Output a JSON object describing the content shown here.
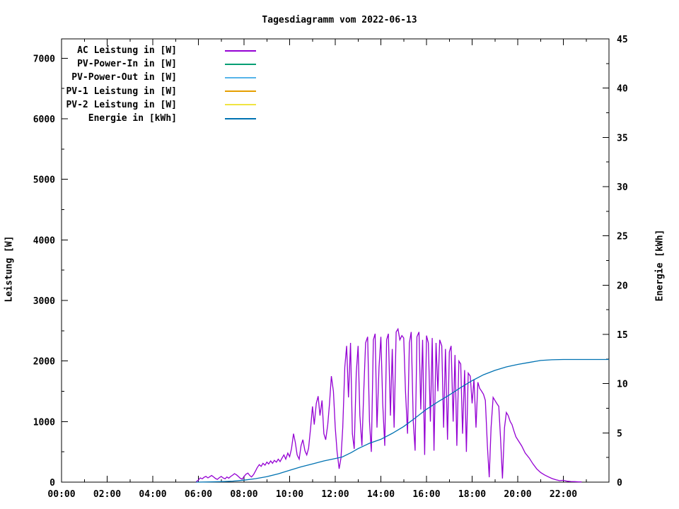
{
  "chart_data": {
    "type": "line",
    "title": "Tagesdiagramm vom 2022-06-13",
    "grid": false,
    "legend_position": "top-left-inside",
    "x_axis": {
      "range_hours": [
        0,
        24
      ],
      "major_tick_every_hours": 2,
      "minor_tick_every_hours": 1,
      "tick_labels": [
        "00:00",
        "02:00",
        "04:00",
        "06:00",
        "08:00",
        "10:00",
        "12:00",
        "14:00",
        "16:00",
        "18:00",
        "20:00",
        "22:00"
      ]
    },
    "y_left": {
      "label": "Leistung [W]",
      "range": [
        0,
        7320
      ],
      "tick_labels": [
        "0",
        "1000",
        "2000",
        "3000",
        "4000",
        "5000",
        "6000",
        "7000"
      ],
      "minor_step": 500
    },
    "y_right": {
      "label": "Energie [kWh]",
      "range": [
        0,
        45
      ],
      "tick_labels": [
        "0",
        "5",
        "10",
        "15",
        "20",
        "25",
        "30",
        "35",
        "40",
        "45"
      ],
      "minor_step": 2.5
    },
    "series": [
      {
        "name": "AC Leistung in [W]",
        "color": "#9400d3",
        "axis": "left",
        "points": [
          [
            5.9,
            5
          ],
          [
            6.0,
            35
          ],
          [
            6.08,
            70
          ],
          [
            6.17,
            55
          ],
          [
            6.25,
            80
          ],
          [
            6.33,
            95
          ],
          [
            6.42,
            70
          ],
          [
            6.5,
            90
          ],
          [
            6.58,
            110
          ],
          [
            6.67,
            85
          ],
          [
            6.75,
            60
          ],
          [
            6.83,
            45
          ],
          [
            6.92,
            75
          ],
          [
            7.0,
            95
          ],
          [
            7.08,
            70
          ],
          [
            7.17,
            55
          ],
          [
            7.25,
            85
          ],
          [
            7.33,
            65
          ],
          [
            7.42,
            95
          ],
          [
            7.5,
            115
          ],
          [
            7.58,
            140
          ],
          [
            7.67,
            120
          ],
          [
            7.75,
            95
          ],
          [
            7.83,
            65
          ],
          [
            7.92,
            50
          ],
          [
            8.0,
            90
          ],
          [
            8.08,
            130
          ],
          [
            8.17,
            150
          ],
          [
            8.25,
            110
          ],
          [
            8.33,
            85
          ],
          [
            8.42,
            125
          ],
          [
            8.5,
            180
          ],
          [
            8.58,
            240
          ],
          [
            8.67,
            290
          ],
          [
            8.75,
            260
          ],
          [
            8.83,
            310
          ],
          [
            8.92,
            280
          ],
          [
            9.0,
            330
          ],
          [
            9.08,
            300
          ],
          [
            9.17,
            350
          ],
          [
            9.25,
            310
          ],
          [
            9.33,
            360
          ],
          [
            9.42,
            330
          ],
          [
            9.5,
            380
          ],
          [
            9.58,
            340
          ],
          [
            9.67,
            400
          ],
          [
            9.75,
            450
          ],
          [
            9.83,
            380
          ],
          [
            9.92,
            480
          ],
          [
            10.0,
            420
          ],
          [
            10.08,
            550
          ],
          [
            10.17,
            800
          ],
          [
            10.25,
            650
          ],
          [
            10.33,
            450
          ],
          [
            10.42,
            380
          ],
          [
            10.5,
            600
          ],
          [
            10.58,
            700
          ],
          [
            10.67,
            520
          ],
          [
            10.75,
            450
          ],
          [
            10.83,
            560
          ],
          [
            10.92,
            900
          ],
          [
            11.0,
            1250
          ],
          [
            11.08,
            950
          ],
          [
            11.17,
            1300
          ],
          [
            11.25,
            1420
          ],
          [
            11.33,
            1100
          ],
          [
            11.42,
            1350
          ],
          [
            11.5,
            800
          ],
          [
            11.58,
            700
          ],
          [
            11.67,
            950
          ],
          [
            11.75,
            1300
          ],
          [
            11.83,
            1750
          ],
          [
            11.92,
            1500
          ],
          [
            12.0,
            900
          ],
          [
            12.08,
            500
          ],
          [
            12.17,
            220
          ],
          [
            12.25,
            400
          ],
          [
            12.33,
            900
          ],
          [
            12.42,
            1900
          ],
          [
            12.5,
            2250
          ],
          [
            12.58,
            1400
          ],
          [
            12.67,
            2300
          ],
          [
            12.75,
            800
          ],
          [
            12.83,
            550
          ],
          [
            12.92,
            1800
          ],
          [
            13.0,
            2250
          ],
          [
            13.08,
            1100
          ],
          [
            13.17,
            600
          ],
          [
            13.25,
            1500
          ],
          [
            13.33,
            2300
          ],
          [
            13.42,
            2400
          ],
          [
            13.5,
            1000
          ],
          [
            13.58,
            500
          ],
          [
            13.67,
            2350
          ],
          [
            13.75,
            2450
          ],
          [
            13.83,
            900
          ],
          [
            13.92,
            1900
          ],
          [
            14.0,
            2400
          ],
          [
            14.08,
            1300
          ],
          [
            14.17,
            600
          ],
          [
            14.25,
            2350
          ],
          [
            14.33,
            2450
          ],
          [
            14.42,
            1100
          ],
          [
            14.5,
            2200
          ],
          [
            14.58,
            900
          ],
          [
            14.67,
            2480
          ],
          [
            14.75,
            2530
          ],
          [
            14.83,
            2350
          ],
          [
            14.92,
            2420
          ],
          [
            15.0,
            2380
          ],
          [
            15.08,
            1500
          ],
          [
            15.17,
            800
          ],
          [
            15.25,
            2300
          ],
          [
            15.33,
            2480
          ],
          [
            15.42,
            1000
          ],
          [
            15.5,
            520
          ],
          [
            15.58,
            2400
          ],
          [
            15.67,
            2480
          ],
          [
            15.75,
            1200
          ],
          [
            15.83,
            2350
          ],
          [
            15.92,
            450
          ],
          [
            16.0,
            2420
          ],
          [
            16.08,
            2300
          ],
          [
            16.17,
            1000
          ],
          [
            16.25,
            2380
          ],
          [
            16.33,
            520
          ],
          [
            16.42,
            2300
          ],
          [
            16.5,
            1500
          ],
          [
            16.58,
            2350
          ],
          [
            16.67,
            2250
          ],
          [
            16.75,
            900
          ],
          [
            16.83,
            2200
          ],
          [
            16.92,
            700
          ],
          [
            17.0,
            2150
          ],
          [
            17.08,
            2250
          ],
          [
            17.17,
            1000
          ],
          [
            17.25,
            2100
          ],
          [
            17.33,
            600
          ],
          [
            17.42,
            2000
          ],
          [
            17.5,
            1950
          ],
          [
            17.58,
            800
          ],
          [
            17.67,
            1850
          ],
          [
            17.75,
            500
          ],
          [
            17.83,
            1800
          ],
          [
            17.92,
            1750
          ],
          [
            18.0,
            1300
          ],
          [
            18.08,
            1700
          ],
          [
            18.17,
            900
          ],
          [
            18.25,
            1650
          ],
          [
            18.33,
            1550
          ],
          [
            18.42,
            1500
          ],
          [
            18.5,
            1450
          ],
          [
            18.58,
            1350
          ],
          [
            18.67,
            600
          ],
          [
            18.75,
            80
          ],
          [
            18.83,
            900
          ],
          [
            18.92,
            1400
          ],
          [
            19.0,
            1350
          ],
          [
            19.08,
            1300
          ],
          [
            19.17,
            1250
          ],
          [
            19.25,
            700
          ],
          [
            19.33,
            60
          ],
          [
            19.42,
            900
          ],
          [
            19.5,
            1150
          ],
          [
            19.58,
            1100
          ],
          [
            19.67,
            1000
          ],
          [
            19.75,
            950
          ],
          [
            19.83,
            850
          ],
          [
            19.92,
            750
          ],
          [
            20.0,
            700
          ],
          [
            20.17,
            600
          ],
          [
            20.33,
            480
          ],
          [
            20.5,
            400
          ],
          [
            20.67,
            300
          ],
          [
            20.83,
            220
          ],
          [
            21.0,
            160
          ],
          [
            21.17,
            120
          ],
          [
            21.33,
            90
          ],
          [
            21.5,
            60
          ],
          [
            21.67,
            40
          ],
          [
            21.83,
            25
          ],
          [
            22.0,
            30
          ],
          [
            22.17,
            15
          ],
          [
            22.33,
            10
          ],
          [
            22.5,
            8
          ],
          [
            22.67,
            5
          ],
          [
            22.8,
            3
          ]
        ]
      },
      {
        "name": "PV-Power-In in [W]",
        "color": "#009e73",
        "axis": "left",
        "points": []
      },
      {
        "name": "PV-Power-Out in [W]",
        "color": "#56b4e9",
        "axis": "left",
        "points": []
      },
      {
        "name": "PV-1 Leistung in [W]",
        "color": "#e69f00",
        "axis": "left",
        "points": []
      },
      {
        "name": "PV-2 Leistung in [W]",
        "color": "#f0e442",
        "axis": "left",
        "points": []
      },
      {
        "name": "Energie in [kWh]",
        "color": "#0072b2",
        "axis": "right",
        "points": [
          [
            5.9,
            0.0
          ],
          [
            6.5,
            0.02
          ],
          [
            7.0,
            0.05
          ],
          [
            7.5,
            0.1
          ],
          [
            8.0,
            0.2
          ],
          [
            8.5,
            0.35
          ],
          [
            9.0,
            0.55
          ],
          [
            9.5,
            0.85
          ],
          [
            10.0,
            1.2
          ],
          [
            10.5,
            1.55
          ],
          [
            11.0,
            1.85
          ],
          [
            11.5,
            2.15
          ],
          [
            12.0,
            2.4
          ],
          [
            12.3,
            2.55
          ],
          [
            12.7,
            3.0
          ],
          [
            13.0,
            3.4
          ],
          [
            13.5,
            3.95
          ],
          [
            14.0,
            4.35
          ],
          [
            14.5,
            4.95
          ],
          [
            15.0,
            5.65
          ],
          [
            15.5,
            6.5
          ],
          [
            16.0,
            7.4
          ],
          [
            16.5,
            8.15
          ],
          [
            17.0,
            8.85
          ],
          [
            17.5,
            9.6
          ],
          [
            18.0,
            10.3
          ],
          [
            18.5,
            10.9
          ],
          [
            19.0,
            11.35
          ],
          [
            19.5,
            11.7
          ],
          [
            20.0,
            11.95
          ],
          [
            20.5,
            12.15
          ],
          [
            21.0,
            12.35
          ],
          [
            21.5,
            12.42
          ],
          [
            22.0,
            12.45
          ],
          [
            23.0,
            12.45
          ],
          [
            24.0,
            12.45
          ]
        ]
      }
    ]
  }
}
